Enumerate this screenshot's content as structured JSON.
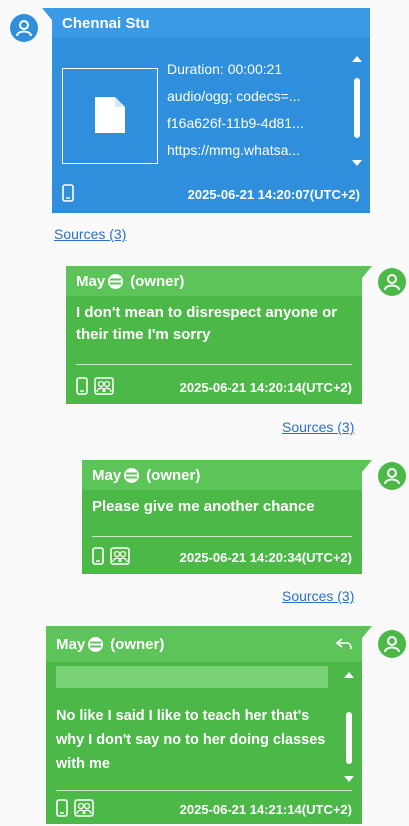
{
  "message1": {
    "sender": "Chennai Stu",
    "attachment_lines": [
      "Duration: 00:00:21",
      "audio/ogg; codecs=...",
      "f16a626f-11b9-4d81...",
      "https://mmg.whatsa..."
    ],
    "timestamp": "2025-06-21 14:20:07(UTC+2)",
    "sources": "Sources (3)"
  },
  "message2": {
    "sender": "May",
    "role": "(owner)",
    "text": "I don't mean to disrespect anyone or their time I'm sorry",
    "timestamp": "2025-06-21 14:20:14(UTC+2)",
    "sources": "Sources (3)"
  },
  "message3": {
    "sender": "May",
    "role": "(owner)",
    "text": "Please give me another chance",
    "timestamp": "2025-06-21 14:20:34(UTC+2)",
    "sources": "Sources (3)"
  },
  "message4": {
    "sender": "May",
    "role": "(owner)",
    "text": "No like I said I like to teach her that's why I don't say no to her doing classes with me",
    "timestamp": "2025-06-21 14:21:14(UTC+2)"
  },
  "colors": {
    "incoming": "#2f8fdc",
    "outgoing": "#4cb848",
    "link": "#2a6fc9"
  }
}
